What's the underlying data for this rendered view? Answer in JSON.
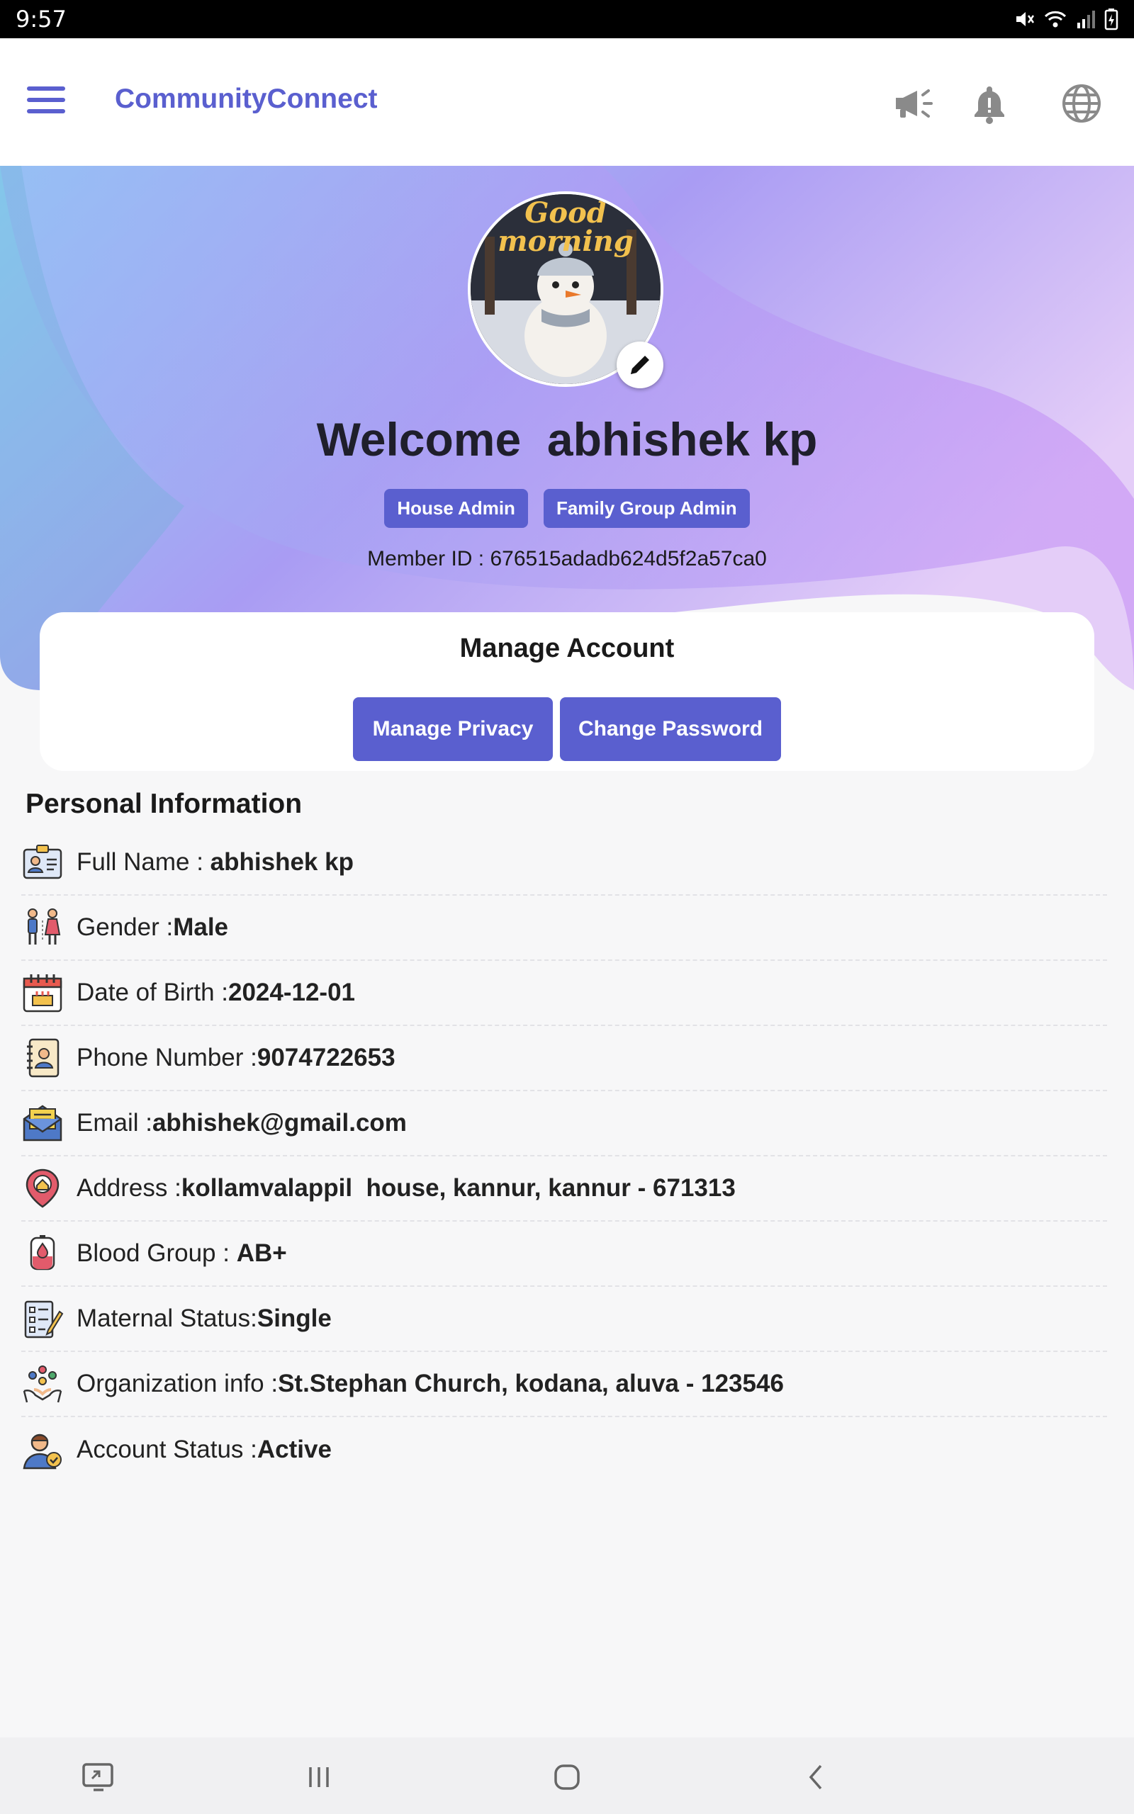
{
  "status_bar": {
    "time": "9:57"
  },
  "app_bar": {
    "title": "CommunityConnect"
  },
  "profile": {
    "welcome": "Welcome  abhishek kp",
    "avatar_text_line1": "Good",
    "avatar_text_line2": "morning",
    "badges": [
      "House Admin",
      "Family Group Admin"
    ],
    "member_id": "Member ID : 676515adadb624d5f2a57ca0"
  },
  "manage_account": {
    "title": "Manage Account",
    "privacy_label": "Manage Privacy",
    "password_label": "Change Password"
  },
  "personal_info": {
    "title": "Personal Information",
    "rows": [
      {
        "icon": "id-card-icon",
        "label": "Full Name : ",
        "value": "abhishek kp"
      },
      {
        "icon": "gender-icon",
        "label": "Gender :",
        "value": "Male"
      },
      {
        "icon": "calendar-icon",
        "label": "Date of Birth :",
        "value": "2024-12-01"
      },
      {
        "icon": "phone-book-icon",
        "label": "Phone Number :",
        "value": "9074722653"
      },
      {
        "icon": "email-icon",
        "label": "Email :",
        "value": "abhishek@gmail.com"
      },
      {
        "icon": "location-pin-icon",
        "label": "Address :",
        "value": "kollamvalappil  house, kannur, kannur - 671313"
      },
      {
        "icon": "blood-bag-icon",
        "label": "Blood Group : ",
        "value": "AB+"
      },
      {
        "icon": "checklist-icon",
        "label": "Maternal Status:",
        "value": "Single"
      },
      {
        "icon": "organization-icon",
        "label": "Organization info :",
        "value": "St.Stephan Church, kodana, aluva - 123546"
      },
      {
        "icon": "account-status-icon",
        "label": "Account Status :",
        "value": "Active"
      }
    ]
  },
  "colors": {
    "accent": "#5a5fcf",
    "hero_start": "#8fd3f4",
    "hero_end": "#c48bf5"
  }
}
